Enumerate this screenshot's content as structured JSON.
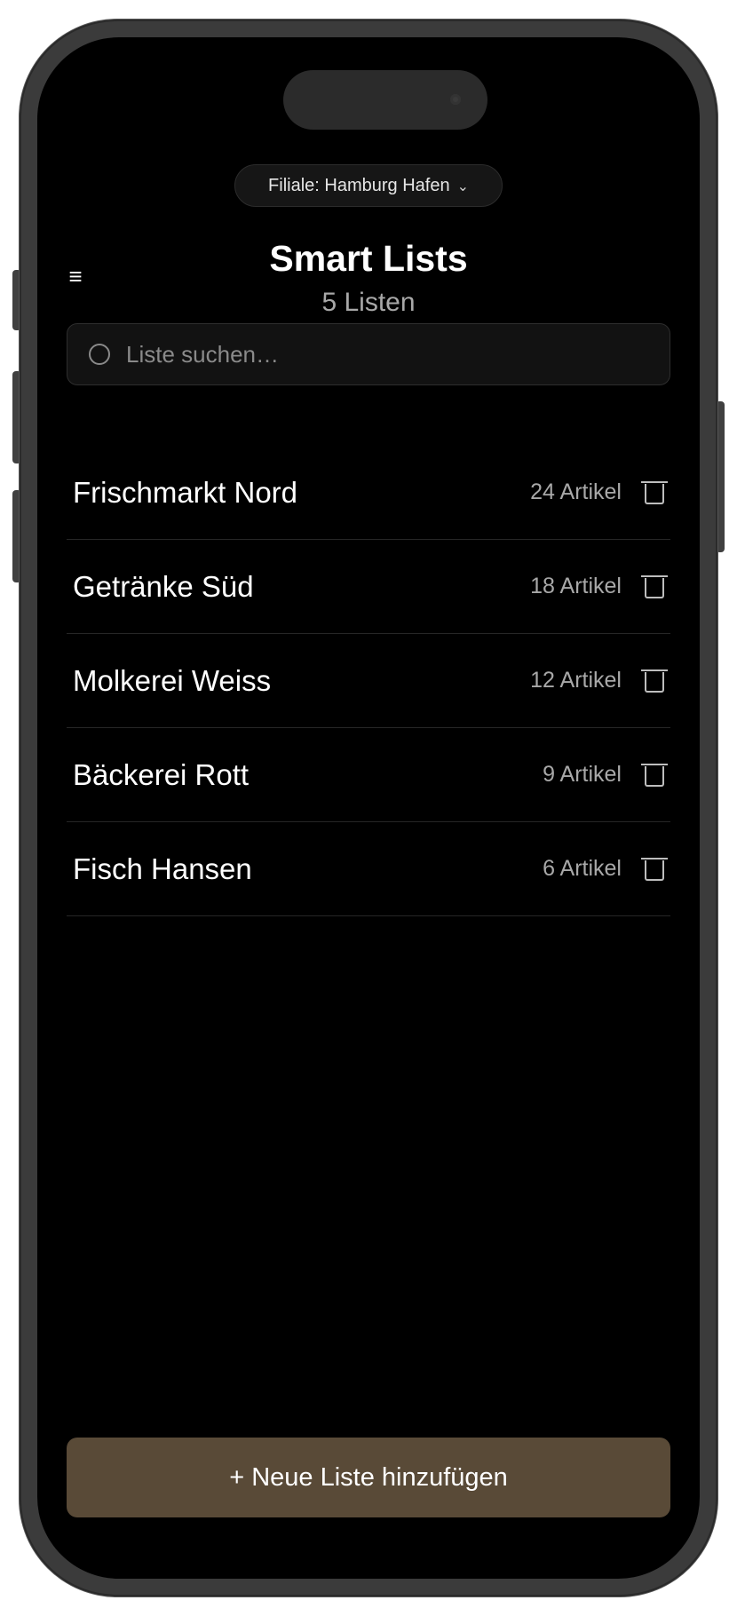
{
  "header": {
    "branch_label": "Filiale: Hamburg Hafen",
    "title": "Smart Lists",
    "subtitle": "5 Listen"
  },
  "search": {
    "placeholder": "Liste suchen…"
  },
  "lists": [
    {
      "name": "Frischmarkt Nord",
      "count": "24 Artikel"
    },
    {
      "name": "Getränke Süd",
      "count": "18 Artikel"
    },
    {
      "name": "Molkerei Weiss",
      "count": "12 Artikel"
    },
    {
      "name": "Bäckerei Rott",
      "count": "9 Artikel"
    },
    {
      "name": "Fisch Hansen",
      "count": "6 Artikel"
    }
  ],
  "footer": {
    "add_label": "+ Neue Liste hinzufügen"
  },
  "icons": {
    "menu": "hamburger-menu-icon",
    "chevron": "chevron-down-icon",
    "search": "search-icon",
    "trash": "trash-icon"
  },
  "colors": {
    "background": "#000000",
    "accent_button": "#594a37",
    "muted_text": "#a8a8a8"
  }
}
